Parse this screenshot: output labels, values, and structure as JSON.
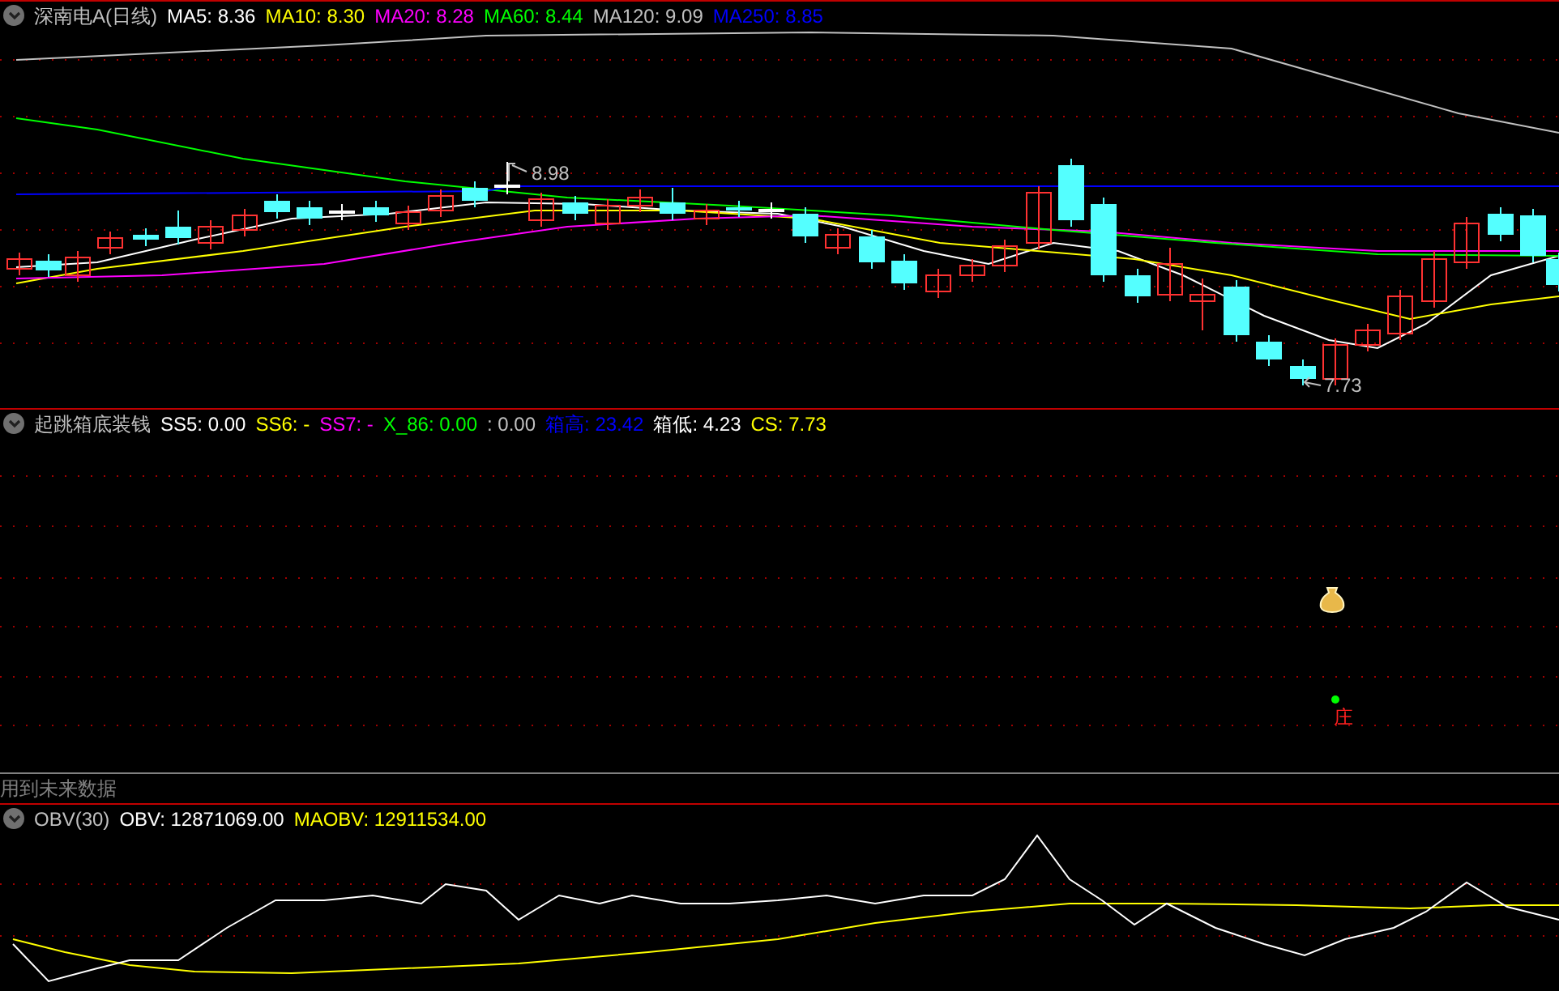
{
  "price_panel": {
    "title": "深南电A(日线)",
    "indicators": [
      {
        "label": "MA5: 8.36",
        "color": "#ffffff"
      },
      {
        "label": "MA10: 8.30",
        "color": "#ffff00"
      },
      {
        "label": "MA20: 8.28",
        "color": "#ff00ff"
      },
      {
        "label": "MA60: 8.44",
        "color": "#00ff00"
      },
      {
        "label": "MA120: 9.09",
        "color": "#c0c0c0"
      },
      {
        "label": "MA250: 8.85",
        "color": "#0000ff"
      }
    ],
    "high_label": "8.98",
    "low_label": "7.73"
  },
  "signal_panel": {
    "title": "起跳箱底装钱",
    "indicators": [
      {
        "label": "SS5: 0.00",
        "color": "#ffffff"
      },
      {
        "label": "SS6: -",
        "color": "#ffff00"
      },
      {
        "label": "SS7: -",
        "color": "#ff00ff"
      },
      {
        "label": "X_86: 0.00",
        "color": "#00ff00"
      },
      {
        "label": ": 0.00",
        "color": "#c0c0c0"
      },
      {
        "label": "箱高: 23.42",
        "color": "#0000ff"
      },
      {
        "label": "箱低: 4.23",
        "color": "#ffffff"
      },
      {
        "label": "CS: 7.73",
        "color": "#ffff00"
      }
    ],
    "marker_text": "庄",
    "note": "用到未来数据"
  },
  "obv_panel": {
    "title": "OBV(30)",
    "indicators": [
      {
        "label": "OBV: 12871069.00",
        "color": "#ffffff"
      },
      {
        "label": "MAOBV: 12911534.00",
        "color": "#ffff00"
      }
    ]
  }
}
